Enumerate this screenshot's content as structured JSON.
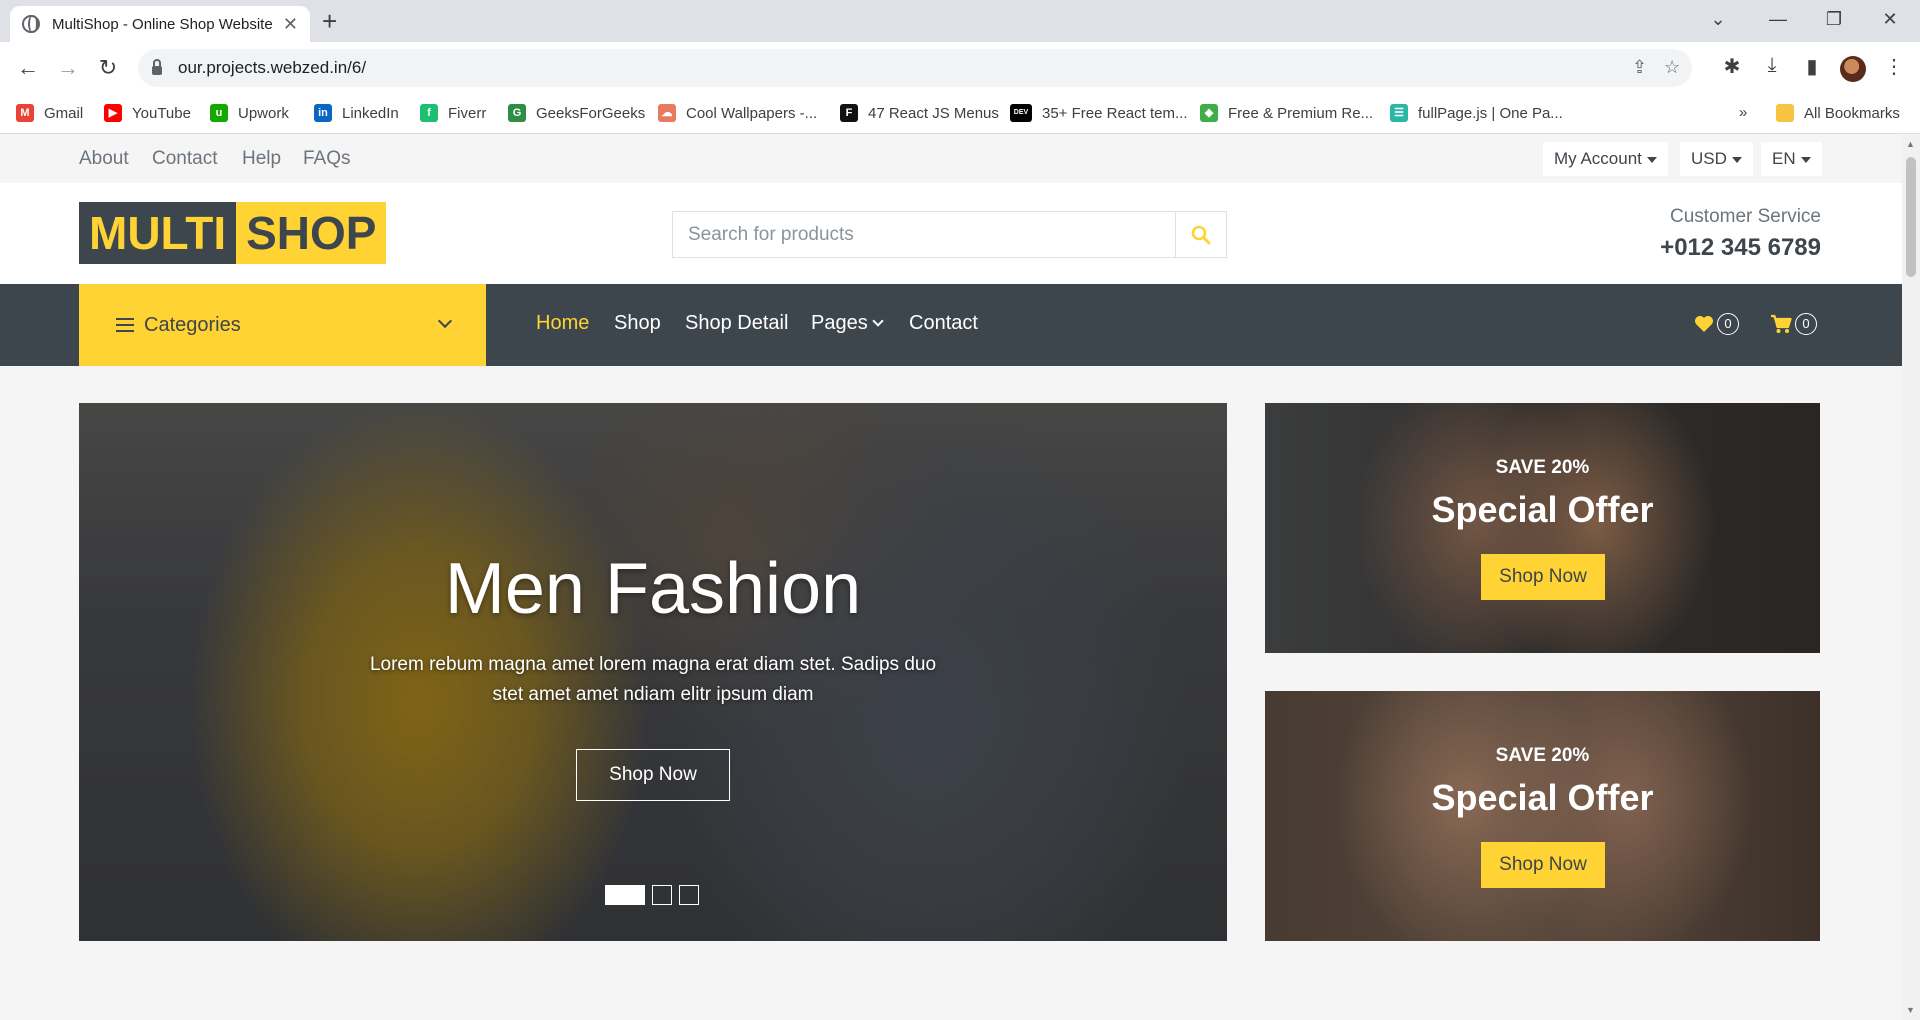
{
  "browser": {
    "tab_title": "MultiShop - Online Shop Website",
    "new_tab": "+",
    "url": "our.projects.webzed.in/6/",
    "bookmarks": [
      {
        "label": "Gmail",
        "color": "#ea4335",
        "glyph": "M"
      },
      {
        "label": "YouTube",
        "color": "#ff0000",
        "glyph": "▶"
      },
      {
        "label": "Upwork",
        "color": "#14a800",
        "glyph": "u"
      },
      {
        "label": "LinkedIn",
        "color": "#0a66c2",
        "glyph": "in"
      },
      {
        "label": "Fiverr",
        "color": "#1dbf73",
        "glyph": "f"
      },
      {
        "label": "GeeksForGeeks",
        "color": "#2f8d46",
        "glyph": "G"
      },
      {
        "label": "Cool Wallpapers -...",
        "color": "#e87a5d",
        "glyph": "☁"
      },
      {
        "label": "47 React JS Menus",
        "color": "#111111",
        "glyph": "F"
      },
      {
        "label": "35+ Free React tem...",
        "color": "#000000",
        "glyph": "DEV"
      },
      {
        "label": "Free & Premium Re...",
        "color": "#3fae49",
        "glyph": "◆"
      },
      {
        "label": "fullPage.js | One Pa...",
        "color": "#2bb7a4",
        "glyph": "☰"
      }
    ],
    "all_bookmarks": "All Bookmarks"
  },
  "topbar": {
    "links": [
      "About",
      "Contact",
      "Help",
      "FAQs"
    ],
    "my_account": "My Account",
    "currency": "USD",
    "language": "EN"
  },
  "header": {
    "logo_part1": "MULTI",
    "logo_part2": "SHOP",
    "search_placeholder": "Search for products",
    "cs_label": "Customer Service",
    "cs_phone": "+012 345 6789"
  },
  "navbar": {
    "categories": "Categories",
    "links": [
      "Home",
      "Shop",
      "Shop Detail",
      "Pages",
      "Contact"
    ],
    "wishlist_count": "0",
    "cart_count": "0"
  },
  "carousel": {
    "title": "Men Fashion",
    "text": "Lorem rebum magna amet lorem magna erat diam stet. Sadips duo stet amet amet ndiam elitr ipsum diam",
    "button": "Shop Now",
    "slide_count": 3,
    "active_slide": 1
  },
  "offers": [
    {
      "small": "SAVE 20%",
      "title": "Special Offer",
      "button": "Shop Now"
    },
    {
      "small": "SAVE 20%",
      "title": "Special Offer",
      "button": "Shop Now"
    }
  ],
  "colors": {
    "accent": "#ffd333",
    "dark": "#3d464d"
  }
}
